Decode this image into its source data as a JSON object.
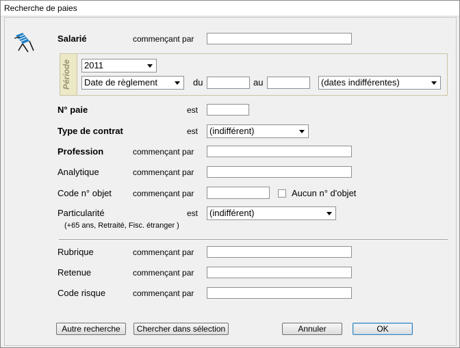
{
  "window": {
    "title": "Recherche de paies"
  },
  "logo": {
    "icon": "palm-chair-logo-icon"
  },
  "salarie": {
    "label": "Salarié",
    "op": "commençant par",
    "value": ""
  },
  "periode": {
    "tab_label": "Période",
    "year": "2011",
    "date_type": "Date de règlement",
    "du_label": "du",
    "du_value": "",
    "au_label": "au",
    "au_value": "",
    "range_mode": "(dates indifférentes)"
  },
  "no_paie": {
    "label": "N° paie",
    "op": "est",
    "value": ""
  },
  "type_contrat": {
    "label": "Type de contrat",
    "op": "est",
    "value": "(indifférent)"
  },
  "profession": {
    "label": "Profession",
    "op": "commençant par",
    "value": ""
  },
  "analytique": {
    "label": "Analytique",
    "op": "commençant par",
    "value": ""
  },
  "code_objet": {
    "label": "Code n° objet",
    "op": "commençant par",
    "value": "",
    "checkbox_label": "Aucun n° d'objet",
    "checked": false
  },
  "particularite": {
    "label": "Particularité",
    "op": "est",
    "value": "(indifférent)",
    "hint": "(+65 ans, Retraité, Fisc. étranger )"
  },
  "rubrique": {
    "label": "Rubrique",
    "op": "commençant par",
    "value": ""
  },
  "retenue": {
    "label": "Retenue",
    "op": "commençant par",
    "value": ""
  },
  "code_risque": {
    "label": "Code risque",
    "op": "commençant par",
    "value": ""
  },
  "buttons": {
    "autre": "Autre recherche",
    "chercher": "Chercher dans sélection",
    "annuler": "Annuler",
    "ok": "OK"
  }
}
